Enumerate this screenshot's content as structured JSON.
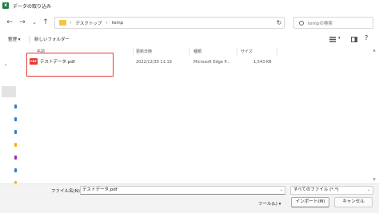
{
  "window": {
    "title": "データの取り込み",
    "app_icon": "excel-icon"
  },
  "nav": {
    "path": [
      "デスクトップ",
      "temp"
    ],
    "search_placeholder": "tempの検索"
  },
  "toolbar": {
    "organize": "整理 ▾",
    "new_folder": "新しいフォルダー"
  },
  "columns": {
    "name": "名前",
    "modified": "更新日時",
    "type": "種類",
    "size": "サイズ"
  },
  "files": [
    {
      "name": "テストデータ.pdf",
      "modified": "2022/12/30 11:19",
      "type": "Microsoft Edge P...",
      "size": "1,543 KB"
    }
  ],
  "colors": {
    "highlight": "#e0403a",
    "pdf": "#e53935",
    "folder": "#f5c542"
  },
  "footer": {
    "filename_label": "ファイル名(N):",
    "filename_value": "テストデータ.pdf",
    "filetype": "すべてのファイル (*.*)",
    "tools": "ツール(L) ▾",
    "import": "インポート(M)",
    "cancel": "キャンセル"
  }
}
